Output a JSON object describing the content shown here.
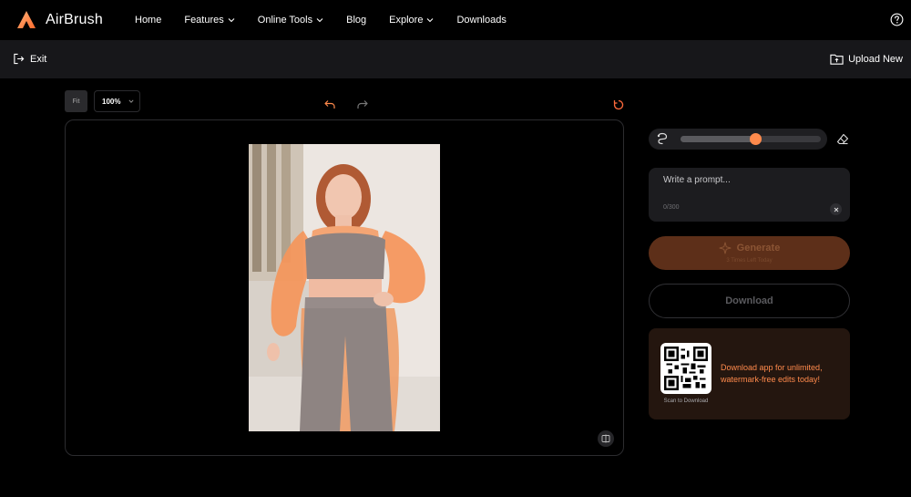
{
  "brand": {
    "name": "AirBrush",
    "accent": "#ff8a4c"
  },
  "nav": {
    "items": [
      {
        "label": "Home",
        "dropdown": false
      },
      {
        "label": "Features",
        "dropdown": true
      },
      {
        "label": "Online Tools",
        "dropdown": true
      },
      {
        "label": "Blog",
        "dropdown": false
      },
      {
        "label": "Explore",
        "dropdown": true
      },
      {
        "label": "Downloads",
        "dropdown": false
      }
    ],
    "help_icon": "help-circle-icon"
  },
  "toolbar": {
    "exit_label": "Exit",
    "upload_label": "Upload New"
  },
  "canvas": {
    "fit_label": "Fit",
    "zoom_value": "100%",
    "photo_alt": "Woman in grey sports bra and leggings with orange-highlighted selection mask"
  },
  "panel": {
    "brush_size_percent": 0.54,
    "prompt": {
      "placeholder": "Write a prompt...",
      "counter": "0/300"
    },
    "generate": {
      "label": "Generate",
      "sub_label": "3 Times Left Today"
    },
    "download_label": "Download",
    "promo": {
      "scan_label": "Scan to Download",
      "text": "Download app for unlimited, watermark-free edits today!"
    }
  }
}
